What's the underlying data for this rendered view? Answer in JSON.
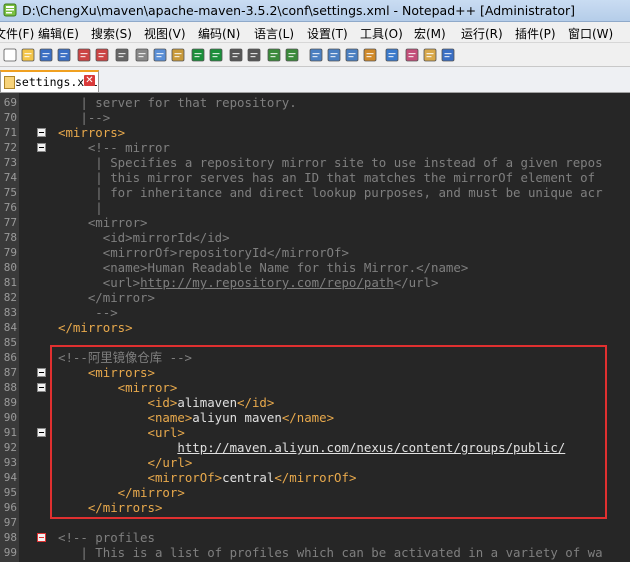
{
  "window": {
    "title": "D:\\ChengXu\\maven\\apache-maven-3.5.2\\conf\\settings.xml - Notepad++ [Administrator]"
  },
  "menu": [
    {
      "label": "文件(F)"
    },
    {
      "label": "编辑(E)"
    },
    {
      "label": "搜索(S)"
    },
    {
      "label": "视图(V)"
    },
    {
      "label": "编码(N)"
    },
    {
      "label": "语言(L)"
    },
    {
      "label": "设置(T)"
    },
    {
      "label": "工具(O)"
    },
    {
      "label": "宏(M)"
    },
    {
      "label": "运行(R)"
    },
    {
      "label": "插件(P)"
    },
    {
      "label": "窗口(W)"
    }
  ],
  "toolbar_icons": [
    "new-file-icon",
    "open-file-icon",
    "save-icon",
    "save-all-icon",
    "close-icon",
    "close-all-icon",
    "print-icon",
    "cut-icon",
    "copy-icon",
    "paste-icon",
    "undo-icon",
    "redo-icon",
    "find-icon",
    "replace-icon",
    "zoom-in-icon",
    "zoom-out-icon",
    "sync-scroll-icon",
    "word-wrap-icon",
    "show-all-chars-icon",
    "indent-guide-icon",
    "doc-map-icon",
    "function-list-icon",
    "folder-workspace-icon",
    "monitor-icon"
  ],
  "tab": {
    "label": "settings.xml"
  },
  "lines": [
    {
      "no": "69",
      "fold": false,
      "tokens": [
        [
          "cm",
          "   | server for that repository."
        ]
      ]
    },
    {
      "no": "70",
      "fold": false,
      "tokens": [
        [
          "cm",
          "   |-->"
        ]
      ]
    },
    {
      "no": "71",
      "fold": true,
      "tokens": [
        [
          "tag",
          "<mirrors>"
        ]
      ]
    },
    {
      "no": "72",
      "fold": true,
      "tokens": [
        [
          "cm",
          "    <!-- mirror"
        ]
      ]
    },
    {
      "no": "73",
      "fold": false,
      "tokens": [
        [
          "cm",
          "     | Specifies a repository mirror site to use instead of a given repos"
        ]
      ]
    },
    {
      "no": "74",
      "fold": false,
      "tokens": [
        [
          "cm",
          "     | this mirror serves has an ID that matches the mirrorOf element of"
        ]
      ]
    },
    {
      "no": "75",
      "fold": false,
      "tokens": [
        [
          "cm",
          "     | for inheritance and direct lookup purposes, and must be unique acr"
        ]
      ]
    },
    {
      "no": "76",
      "fold": false,
      "tokens": [
        [
          "cm",
          "     |"
        ]
      ]
    },
    {
      "no": "77",
      "fold": false,
      "tokens": [
        [
          "cm",
          "    <mirror>"
        ]
      ]
    },
    {
      "no": "78",
      "fold": false,
      "tokens": [
        [
          "cm",
          "      <id>mirrorId</id>"
        ]
      ]
    },
    {
      "no": "79",
      "fold": false,
      "tokens": [
        [
          "cm",
          "      <mirrorOf>repositoryId</mirrorOf>"
        ]
      ]
    },
    {
      "no": "80",
      "fold": false,
      "tokens": [
        [
          "cm",
          "      <name>Human Readable Name for this Mirror.</name>"
        ]
      ]
    },
    {
      "no": "81",
      "fold": false,
      "tokens": [
        [
          "cm",
          "      <url>"
        ],
        [
          "cmurl",
          "http://my.repository.com/repo/path"
        ],
        [
          "cm",
          "</url>"
        ]
      ]
    },
    {
      "no": "82",
      "fold": false,
      "tokens": [
        [
          "cm",
          "    </mirror>"
        ]
      ]
    },
    {
      "no": "83",
      "fold": false,
      "tokens": [
        [
          "cm",
          "     -->"
        ]
      ]
    },
    {
      "no": "84",
      "fold": false,
      "tokens": [
        [
          "tag",
          "</mirrors>"
        ]
      ]
    },
    {
      "no": "85",
      "fold": false,
      "tokens": [
        [
          "txt",
          ""
        ]
      ]
    },
    {
      "no": "86",
      "fold": false,
      "tokens": [
        [
          "cm",
          "<!--阿里镜像仓库 -->"
        ]
      ]
    },
    {
      "no": "87",
      "fold": true,
      "tokens": [
        [
          "tag",
          "    <mirrors>"
        ]
      ]
    },
    {
      "no": "88",
      "fold": true,
      "tokens": [
        [
          "tag",
          "        <mirror>"
        ]
      ]
    },
    {
      "no": "89",
      "fold": false,
      "tokens": [
        [
          "tag",
          "            <id>"
        ],
        [
          "txt",
          "alimaven"
        ],
        [
          "tag",
          "</id>"
        ]
      ]
    },
    {
      "no": "90",
      "fold": false,
      "tokens": [
        [
          "tag",
          "            <name>"
        ],
        [
          "txt",
          "aliyun maven"
        ],
        [
          "tag",
          "</name>"
        ]
      ]
    },
    {
      "no": "91",
      "fold": true,
      "tokens": [
        [
          "tag",
          "            <url>"
        ]
      ]
    },
    {
      "no": "92",
      "fold": false,
      "tokens": [
        [
          "txt",
          "                "
        ],
        [
          "url",
          "http://maven.aliyun.com/nexus/content/groups/public/"
        ]
      ]
    },
    {
      "no": "93",
      "fold": false,
      "tokens": [
        [
          "tag",
          "            </url>"
        ]
      ]
    },
    {
      "no": "94",
      "fold": false,
      "tokens": [
        [
          "tag",
          "            <mirrorOf>"
        ],
        [
          "txt",
          "central"
        ],
        [
          "tag",
          "</mirrorOf>"
        ]
      ]
    },
    {
      "no": "95",
      "fold": false,
      "tokens": [
        [
          "tag",
          "        </mirror>"
        ]
      ]
    },
    {
      "no": "96",
      "fold": false,
      "tokens": [
        [
          "tag",
          "    </mirrors>"
        ]
      ]
    },
    {
      "no": "97",
      "fold": false,
      "tokens": [
        [
          "txt",
          ""
        ]
      ]
    },
    {
      "no": "98",
      "fold": "red",
      "tokens": [
        [
          "cm",
          "<!-- profiles"
        ]
      ]
    },
    {
      "no": "99",
      "fold": false,
      "tokens": [
        [
          "cm",
          "   | This is a list of profiles which can be activated in a variety of wa"
        ]
      ]
    }
  ]
}
